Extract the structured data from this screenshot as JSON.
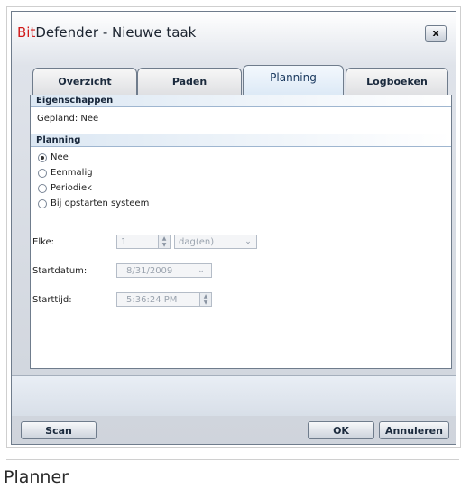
{
  "window": {
    "title_brand": "Bit",
    "title_rest": "Defender - Nieuwe taak",
    "close_label": "x"
  },
  "tabs": [
    {
      "label": "Overzicht"
    },
    {
      "label": "Paden"
    },
    {
      "label": "Planning"
    },
    {
      "label": "Logboeken"
    }
  ],
  "properties": {
    "heading": "Eigenschappen",
    "scheduled": "Gepland: Nee"
  },
  "planning": {
    "heading": "Planning",
    "options": [
      {
        "label": "Nee",
        "selected": true
      },
      {
        "label": "Eenmalig",
        "selected": false
      },
      {
        "label": "Periodiek",
        "selected": false
      },
      {
        "label": "Bij opstarten systeem",
        "selected": false
      }
    ]
  },
  "fields": {
    "every_label": "Elke:",
    "every_value": "1",
    "every_unit": "dag(en)",
    "start_date_label": "Startdatum:",
    "start_date_value": "8/31/2009",
    "start_time_label": "Starttijd:",
    "start_time_value": "5:36:24 PM"
  },
  "buttons": {
    "scan": "Scan",
    "ok": "OK",
    "cancel": "Annuleren"
  },
  "caption": "Planner"
}
